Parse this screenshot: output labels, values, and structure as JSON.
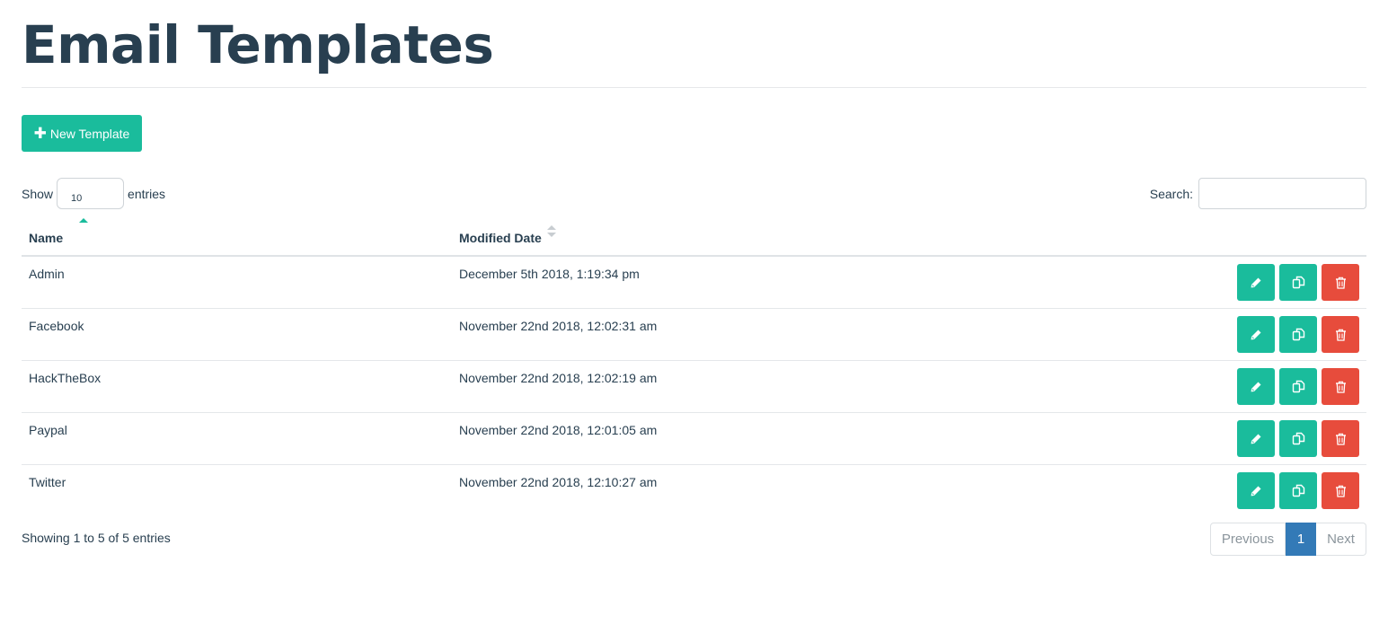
{
  "page": {
    "title": "Email Templates"
  },
  "toolbar": {
    "new_template_icon": "plus-icon",
    "new_template_label": "New Template"
  },
  "length": {
    "show_label": "Show",
    "value": "10",
    "entries_label": "entries"
  },
  "search": {
    "label": "Search:",
    "value": ""
  },
  "table": {
    "columns": [
      {
        "label": "Name",
        "sort": "ascending"
      },
      {
        "label": "Modified Date",
        "sort": "none"
      }
    ],
    "rows": [
      {
        "name": "Admin",
        "modified": "December 5th 2018, 1:19:34 pm"
      },
      {
        "name": "Facebook",
        "modified": "November 22nd 2018, 12:02:31 am"
      },
      {
        "name": "HackTheBox",
        "modified": "November 22nd 2018, 12:02:19 am"
      },
      {
        "name": "Paypal",
        "modified": "November 22nd 2018, 12:01:05 am"
      },
      {
        "name": "Twitter",
        "modified": "November 22nd 2018, 12:10:27 am"
      }
    ],
    "row_actions": [
      "edit-icon",
      "copy-icon",
      "trash-icon"
    ]
  },
  "footer": {
    "info": "Showing 1 to 5 of 5 entries",
    "previous_label": "Previous",
    "current_page": "1",
    "next_label": "Next"
  },
  "colors": {
    "accent": "#1abc9c",
    "danger": "#e74c3c",
    "active_page": "#337ab7",
    "text": "#283f50"
  }
}
